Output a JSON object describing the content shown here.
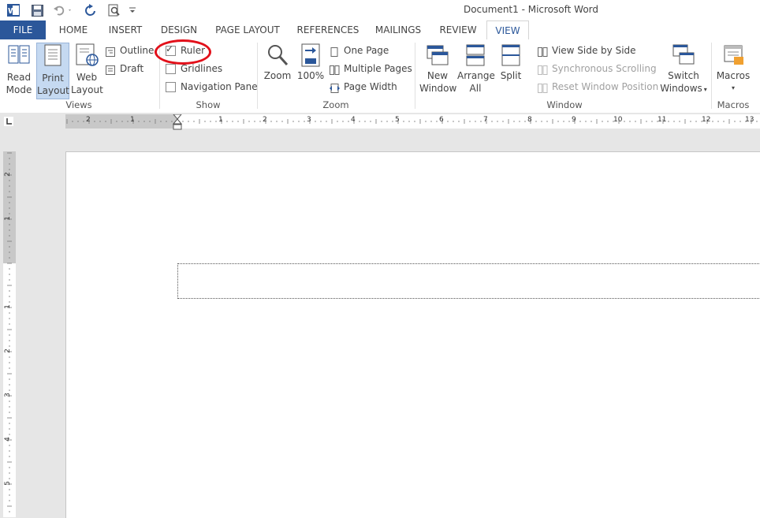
{
  "window": {
    "title": "Document1 - Microsoft Word"
  },
  "tabs": [
    {
      "label": "FILE"
    },
    {
      "label": "HOME"
    },
    {
      "label": "INSERT"
    },
    {
      "label": "DESIGN"
    },
    {
      "label": "PAGE LAYOUT"
    },
    {
      "label": "REFERENCES"
    },
    {
      "label": "MAILINGS"
    },
    {
      "label": "REVIEW"
    },
    {
      "label": "VIEW"
    }
  ],
  "ribbon": {
    "views": {
      "label": "Views",
      "read_mode": [
        "Read",
        "Mode"
      ],
      "print_layout": [
        "Print",
        "Layout"
      ],
      "web_layout": [
        "Web",
        "Layout"
      ],
      "outline": "Outline",
      "draft": "Draft"
    },
    "show": {
      "label": "Show",
      "ruler": {
        "label": "Ruler",
        "checked": true
      },
      "gridlines": {
        "label": "Gridlines",
        "checked": false
      },
      "navigation_pane": {
        "label": "Navigation Pane",
        "checked": false
      }
    },
    "zoom": {
      "label": "Zoom",
      "zoom": "Zoom",
      "hundred": "100%",
      "one_page": "One Page",
      "multiple_pages": "Multiple Pages",
      "page_width": "Page Width"
    },
    "window": {
      "label": "Window",
      "new_window": [
        "New",
        "Window"
      ],
      "arrange_all": [
        "Arrange",
        "All"
      ],
      "split": "Split",
      "view_side_by_side": "View Side by Side",
      "synchronous_scrolling": "Synchronous Scrolling",
      "reset_window_position": "Reset Window Position",
      "switch_windows": [
        "Switch",
        "Windows"
      ]
    },
    "macros": {
      "label": "Macros",
      "macros": "Macros"
    }
  },
  "hruler": {
    "numbers": [
      "2",
      "1",
      "1",
      "2",
      "3",
      "4",
      "5",
      "6",
      "7",
      "8",
      "9",
      "10",
      "11",
      "12",
      "13"
    ]
  },
  "vruler": {
    "numbers": [
      "2",
      "1",
      "1",
      "2",
      "3",
      "4",
      "5"
    ]
  },
  "colors": {
    "accent": "#2b579a",
    "highlight": "#e2101a"
  },
  "icons": [
    "word-logo-icon",
    "save-icon",
    "undo-icon",
    "redo-icon",
    "print-preview-icon",
    "customize-qat-icon"
  ]
}
